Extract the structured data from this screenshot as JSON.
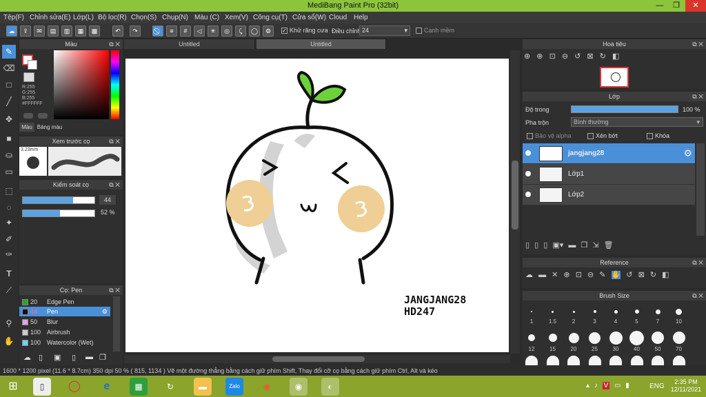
{
  "window": {
    "title": "MediBang Paint Pro (32bit)",
    "minimize": "—",
    "maximize": "❐",
    "close": "✕"
  },
  "menu": [
    "Tệp(F)",
    "Chỉnh sửa(E)",
    "Lớp(L)",
    "Bộ lọc(R)",
    "Chọn(S)",
    "Chụp(N)",
    "Màu (C)",
    "Xem(V)",
    "Công cụ(T)",
    "Cửa sổ(W)",
    "Cloud",
    "Help"
  ],
  "toolbar": {
    "antialias_label": "Khử răng cưa",
    "adjust_label": "Điều chỉnh",
    "adjust_value": "24",
    "edge_label": "Cạnh mềm"
  },
  "color_panel": {
    "title": "Màu",
    "r": "R:255",
    "g": "G:255",
    "b": "B:255",
    "hex": "#FFFFFF",
    "tab_color": "Màu",
    "tab_palette": "Bảng màu"
  },
  "brush_preview": {
    "title": "Xem trước cọ",
    "size": "3.23mm"
  },
  "brush_control": {
    "title": "Kiểm soát cọ",
    "size_value": "44",
    "opacity_value": "52",
    "opacity_unit": "%",
    "size_fill": 0.7,
    "opacity_fill": 0.52
  },
  "brush_list": {
    "title": "Cọ: Pen",
    "items": [
      {
        "size": "20",
        "name": "Edge Pen",
        "color": "#2aa52a"
      },
      {
        "size": "44",
        "name": "Pen",
        "color": "#111111"
      },
      {
        "size": "50",
        "name": "Blur",
        "color": "#e6a0e6"
      },
      {
        "size": "100",
        "name": "Airbrush",
        "color": "#cccccc"
      },
      {
        "size": "100",
        "name": "Watercolor (Wet)",
        "color": "#6ad6f0"
      }
    ]
  },
  "tabs": [
    "Untitled",
    "Untitled"
  ],
  "canvas": {
    "signature_line1": "JANGJANG28",
    "signature_line2": "HD247"
  },
  "navigator": {
    "title": "Hoa tiêu"
  },
  "layers": {
    "title": "Lớp",
    "opacity_label": "Độ trong",
    "opacity_value": "100 %",
    "blend_label": "Pha trộn",
    "blend_value": "Bình thường",
    "protect_alpha": "Bảo vệ alpha",
    "clipping": "Xén bớt",
    "lock": "Khóa",
    "items": [
      "jangjang28",
      "Lớp1",
      "Lớp2"
    ]
  },
  "reference": {
    "title": "Reference"
  },
  "brush_size": {
    "title": "Brush Size",
    "row1": [
      "1",
      "1.5",
      "2",
      "3",
      "4",
      "5",
      "7",
      "10"
    ],
    "row2": [
      "12",
      "15",
      "20",
      "25",
      "30",
      "40",
      "50",
      "70"
    ]
  },
  "status": "1600 * 1200 pixel   (11.6 * 8.7cm)  350 dpi   50 %   ( 815, 1134 )   Vẽ một đường thẳng bằng cách giữ phím Shift, Thay đổi cỡ cọ bằng cách giữ phím Ctrl, Alt và kéo",
  "taskbar": {
    "language": "ENG",
    "time": "2:35 PM",
    "date": "12/11/2021"
  }
}
